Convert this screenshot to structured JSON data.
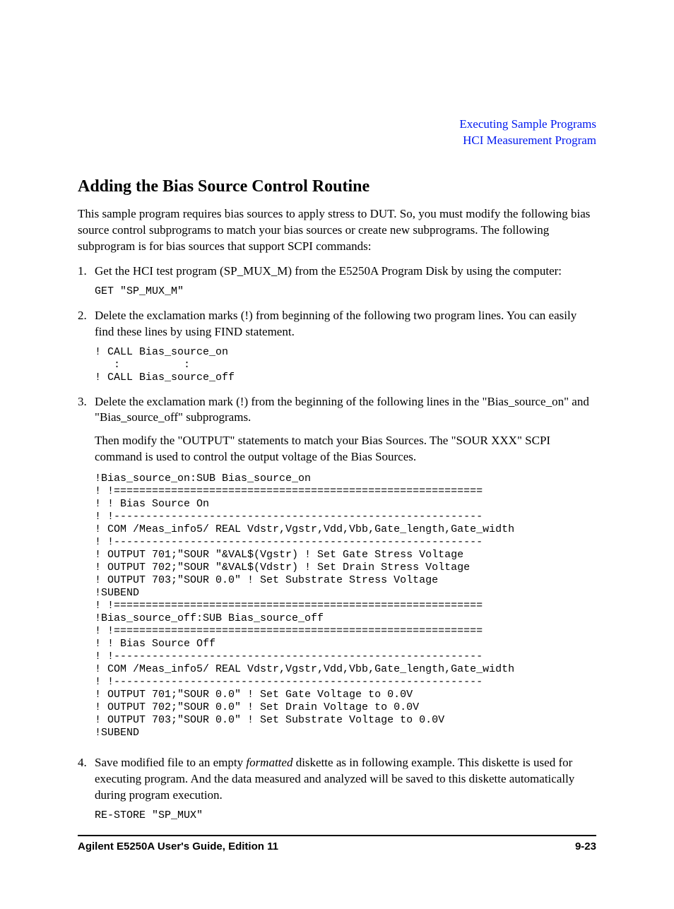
{
  "header": {
    "line1": "Executing Sample Programs",
    "line2": "HCI Measurement Program"
  },
  "heading": "Adding the Bias Source Control Routine",
  "intro": "This sample program requires bias sources to apply stress to DUT. So, you must modify the following bias source control subprograms to match your bias sources or create new subprograms. The following subprogram is for bias sources that support SCPI commands:",
  "steps": {
    "s1": {
      "num": "1.",
      "text": "Get the HCI test program (SP_MUX_M) from the E5250A Program Disk by using the computer:",
      "code": "GET \"SP_MUX_M\""
    },
    "s2": {
      "num": "2.",
      "text": "Delete the exclamation marks (!) from beginning of the following two program lines. You can easily find these lines by using FIND statement.",
      "code": "! CALL Bias_source_on\n   :          :\n! CALL Bias_source_off"
    },
    "s3": {
      "num": "3.",
      "text1": "Delete the exclamation mark (!) from the beginning of the following lines in the \"Bias_source_on\" and \"Bias_source_off\" subprograms.",
      "text2": "Then modify the \"OUTPUT\" statements to match your Bias Sources. The \"SOUR XXX\" SCPI command is used to control the output voltage of the Bias Sources.",
      "code": "!Bias_source_on:SUB Bias_source_on\n! !==========================================================\n! ! Bias Source On\n! !----------------------------------------------------------\n! COM /Meas_info5/ REAL Vdstr,Vgstr,Vdd,Vbb,Gate_length,Gate_width\n! !----------------------------------------------------------\n! OUTPUT 701;\"SOUR \"&VAL$(Vgstr) ! Set Gate Stress Voltage\n! OUTPUT 702;\"SOUR \"&VAL$(Vdstr) ! Set Drain Stress Voltage\n! OUTPUT 703;\"SOUR 0.0\" ! Set Substrate Stress Voltage\n!SUBEND\n! !==========================================================\n!Bias_source_off:SUB Bias_source_off\n! !==========================================================\n! ! Bias Source Off\n! !----------------------------------------------------------\n! COM /Meas_info5/ REAL Vdstr,Vgstr,Vdd,Vbb,Gate_length,Gate_width\n! !----------------------------------------------------------\n! OUTPUT 701;\"SOUR 0.0\" ! Set Gate Voltage to 0.0V\n! OUTPUT 702;\"SOUR 0.0\" ! Set Drain Voltage to 0.0V\n! OUTPUT 703;\"SOUR 0.0\" ! Set Substrate Voltage to 0.0V\n!SUBEND"
    },
    "s4": {
      "num": "4.",
      "text_pre": "Save modified file to an empty ",
      "text_italic": "formatted",
      "text_post": " diskette as in following example. This diskette is used for executing program. And the data measured and analyzed will be saved to this diskette automatically during program execution.",
      "code": "RE-STORE \"SP_MUX\""
    }
  },
  "footer": {
    "left": "Agilent E5250A User's Guide, Edition 11",
    "right": "9-23"
  }
}
